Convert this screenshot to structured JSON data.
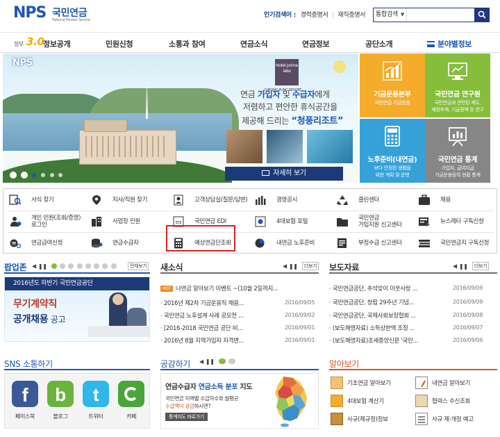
{
  "header": {
    "logo_main": "NPS",
    "logo_kr": "국민연금",
    "logo_en": "National Pension Service",
    "popular_label": "인기검색어 :",
    "popular_1": "경력증명서",
    "popular_sep": "|",
    "popular_2": "재직증명서",
    "search_select": "통합검색",
    "search_placeholder": ""
  },
  "gnb": {
    "gov_prefix": "정부",
    "gov_version": "3.0",
    "gov_title": "정보공개",
    "items": [
      "민원신청",
      "소통과 참여",
      "연금소식",
      "연금정보",
      "공단소개"
    ],
    "field": "분야별정보"
  },
  "hero": {
    "nps": "NPS",
    "sign": "Hotel prime lake",
    "sign2": "CHEONG PUNG RESORT",
    "line1_a": "연금 ",
    "line1_b": "가입자",
    "line1_c": " 및 ",
    "line1_d": "수급자",
    "line1_e": "에게",
    "line2": "저렴하고 편안한 휴식공간을",
    "line3_a": "제공해 드리는 ",
    "line3_b": "“청풍리조트”",
    "more": "자세히 보기"
  },
  "tiles": [
    {
      "title": "기금운용본부",
      "sub1": "국민연금 기금운용",
      "sub2": "",
      "color": "#f5ac2a"
    },
    {
      "title": "국민연금 연구원",
      "sub1": "국민연금과 관련된 제도,",
      "sub2": "재정추계, 기금정책 등 연구",
      "color": "#86bd3b"
    },
    {
      "title": "노후준비(내연금)",
      "sub1": "보다 안정된 생활을",
      "sub2": "위한 계획 및 운영",
      "color": "#36a1d8"
    },
    {
      "title": "국민연금 통계",
      "sub1": "가입자, 급여지급",
      "sub2": "기금운용등의 현황 통계",
      "color": "#868686"
    }
  ],
  "quick": {
    "r1": [
      "서식 찾기",
      "지사/직원 찾기",
      "고객상담실(질문/답변)",
      "경영공시",
      "클린센터",
      "채용"
    ],
    "r2a": [
      "개인 민원(조회/증명)",
      "",
      "국민연금 EDI",
      "4대보험 포털",
      "국민연금",
      "뉴스레터 구독신청"
    ],
    "r2b": [
      "로그인",
      "",
      "",
      "",
      "가입지원 신고센터",
      ""
    ],
    "r2_sa": "사업장 민원",
    "r3": [
      "연금급여신청",
      "연금수급자",
      "예상연금단조회",
      "내연금 노후준비",
      "부정수급 신고센터",
      "국민연금지 구독신청"
    ]
  },
  "popup": {
    "title": "팝업존",
    "all": "전체보기",
    "banner_top": "2016년도 하반기 국민연금공단",
    "banner_line1": "무기계약직",
    "banner_line2a": "공개채용",
    "banner_line2b": " 공고"
  },
  "news": {
    "title": "새소식",
    "more": "더보기",
    "hot": "HOT",
    "hot_title": "나연금 알아보기 이벤트 ~(10월 2일까지...",
    "items": [
      {
        "t": "2016년 제2차 기금운용직 채용...",
        "d": "2016/09/05"
      },
      {
        "t": "국민연금 노후설계 사례 공모전 ...",
        "d": "2016/09/02"
      },
      {
        "t": "[2016-2018 국민연금 공단 비...",
        "d": "2016/09/01"
      },
      {
        "t": "2016년 8월 지역가입자 자격변...",
        "d": "2016/09/01"
      }
    ]
  },
  "press": {
    "title": "보도자료",
    "more": "더보기",
    "items": [
      {
        "t": "국민연금공단, 추석맞이 이웃사랑 ...",
        "d": "2016/09/09"
      },
      {
        "t": "국민연금공단, 창립 29주년 기념...",
        "d": "2016/09/09"
      },
      {
        "t": "국민연금공단, 국제사회보장협회 ...",
        "d": "2016/09/08"
      },
      {
        "t": "(보도해명자료) 소득상한액 조정 ...",
        "d": "2016/09/07"
      },
      {
        "t": "(보도해명자료)조세중앙신문 '국민...",
        "d": "2016/09/06"
      }
    ]
  },
  "sns": {
    "title": "SNS 소통하기",
    "items": [
      "페이스북",
      "블로그",
      "트위터",
      "카페"
    ]
  },
  "share": {
    "title": "공감하기",
    "l1a": "연금수급자 ",
    "l1b": "연금소득 분포",
    "l1c": " 지도",
    "l2": "국민연금 지역별 수급자수와 월평균",
    "l3a": "수급액이 궁금",
    "l3b": "하시면?",
    "btn": "통계지도 바로가기"
  },
  "know": {
    "title": "알아보기",
    "items": [
      "기초연금 알아보기",
      "내연금 알아보기",
      "4대보험 계산기",
      "협력스 수신조회",
      "사규(제규정)정보",
      "사규 제·개정 예고"
    ]
  },
  "colors": {
    "brand": "#1e56b5",
    "navy": "#20377d",
    "highlight": "#e21d1d"
  }
}
